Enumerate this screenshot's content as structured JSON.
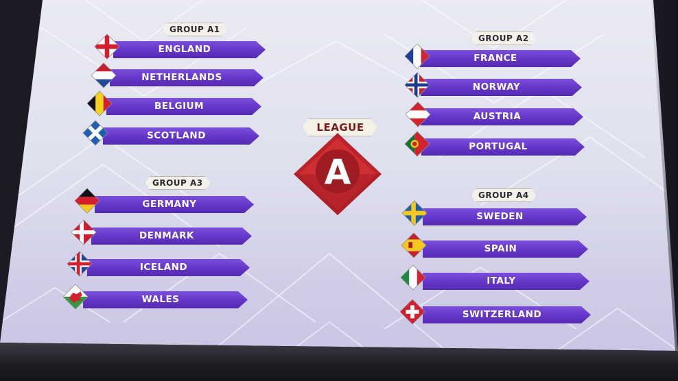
{
  "league": {
    "label": "LEAGUE",
    "letter": "A",
    "color": "#c22a2e"
  },
  "bar_color": "#6435c7",
  "groups": [
    {
      "label": "GROUP A1",
      "teams": [
        {
          "name": "ENGLAND",
          "flag": "england-flag-icon"
        },
        {
          "name": "NETHERLANDS",
          "flag": "netherlands-flag-icon"
        },
        {
          "name": "BELGIUM",
          "flag": "belgium-flag-icon"
        },
        {
          "name": "SCOTLAND",
          "flag": "scotland-flag-icon"
        }
      ]
    },
    {
      "label": "GROUP A2",
      "teams": [
        {
          "name": "FRANCE",
          "flag": "france-flag-icon"
        },
        {
          "name": "NORWAY",
          "flag": "norway-flag-icon"
        },
        {
          "name": "AUSTRIA",
          "flag": "austria-flag-icon"
        },
        {
          "name": "PORTUGAL",
          "flag": "portugal-flag-icon"
        }
      ]
    },
    {
      "label": "GROUP A3",
      "teams": [
        {
          "name": "GERMANY",
          "flag": "germany-flag-icon"
        },
        {
          "name": "DENMARK",
          "flag": "denmark-flag-icon"
        },
        {
          "name": "ICELAND",
          "flag": "iceland-flag-icon"
        },
        {
          "name": "WALES",
          "flag": "wales-flag-icon"
        }
      ]
    },
    {
      "label": "GROUP A4",
      "teams": [
        {
          "name": "SWEDEN",
          "flag": "sweden-flag-icon"
        },
        {
          "name": "SPAIN",
          "flag": "spain-flag-icon"
        },
        {
          "name": "ITALY",
          "flag": "italy-flag-icon"
        },
        {
          "name": "SWITZERLAND",
          "flag": "switzerland-flag-icon"
        }
      ]
    }
  ]
}
